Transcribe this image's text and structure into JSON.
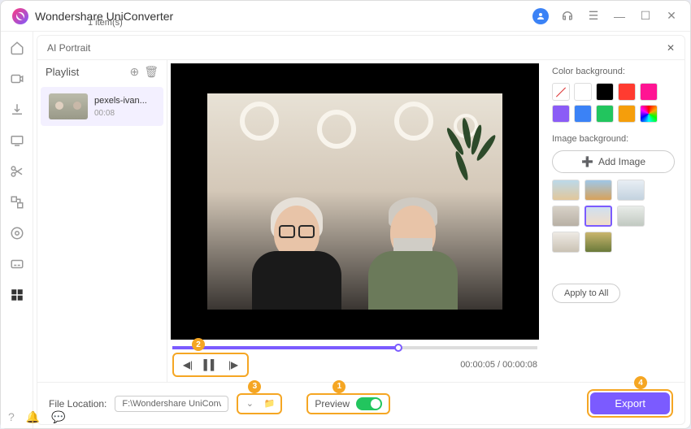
{
  "app": {
    "title": "Wondershare UniConverter"
  },
  "modal": {
    "title": "AI Portrait"
  },
  "playlist": {
    "title": "Playlist",
    "item": {
      "name": "pexels-ivan...",
      "duration": "00:08"
    },
    "count_text": "1 item(s)"
  },
  "timeline": {
    "time_text": "00:00:05 / 00:00:08",
    "progress_pct": 62
  },
  "footer": {
    "location_label": "File Location:",
    "location_value": "F:\\Wondershare UniConverter",
    "preview_label": "Preview",
    "export_label": "Export"
  },
  "right": {
    "color_bg_label": "Color background:",
    "image_bg_label": "Image background:",
    "add_image_label": "Add Image",
    "apply_all_label": "Apply to All",
    "colors": [
      "none",
      "#ffffff",
      "#000000",
      "#ff3b30",
      "#ff1493",
      "#8b5cf6",
      "#3b82f6",
      "#22c55e",
      "#f59e0b",
      "rainbow"
    ],
    "bg_thumbs": [
      {
        "bg": "linear-gradient(#bcd9ea,#e2c79a)",
        "sel": false
      },
      {
        "bg": "linear-gradient(#9fc7e8,#d8a25a)",
        "sel": false
      },
      {
        "bg": "linear-gradient(#e8eef4,#c3d2df)",
        "sel": false
      },
      {
        "bg": "linear-gradient(#d8d2c8,#b8b0a5)",
        "sel": false
      },
      {
        "bg": "linear-gradient(#cfe0f0,#f2ddc8)",
        "sel": true
      },
      {
        "bg": "linear-gradient(#e8ece8,#c1c9c1)",
        "sel": false
      },
      {
        "bg": "linear-gradient(#eeeae4,#cac2b4)",
        "sel": false
      },
      {
        "bg": "linear-gradient(#c9b56e,#6a7a3a)",
        "sel": false
      }
    ]
  },
  "badges": {
    "one": "1",
    "two": "2",
    "three": "3",
    "four": "4"
  }
}
